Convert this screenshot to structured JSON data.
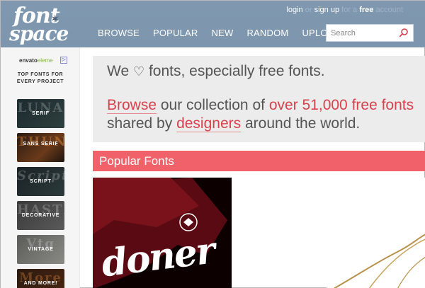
{
  "logo": {
    "line1": "font",
    "line2": "space"
  },
  "auth": {
    "login": "login",
    "or": "or",
    "signup": "sign up",
    "for_a": "for a",
    "free": "free",
    "account": "account"
  },
  "nav": {
    "items": [
      "BROWSE",
      "POPULAR",
      "NEW",
      "RANDOM",
      "UPLOAD"
    ]
  },
  "search": {
    "placeholder": "Search",
    "value": ""
  },
  "sidebar": {
    "ad_brand_a": "envato",
    "ad_brand_b": "eleme",
    "ad_choice": "▷",
    "ad_heading": "TOP FONTS FOR EVERY PROJECT",
    "categories": [
      {
        "label": "SERIF",
        "deco": "LUNA"
      },
      {
        "label": "SANS SERIF",
        "deco": "THUN"
      },
      {
        "label": "SCRIPT",
        "deco": "Script"
      },
      {
        "label": "DECORATIVE",
        "deco": "HASTE"
      },
      {
        "label": "VINTAGE",
        "deco": "Vtg"
      },
      {
        "label": "AND MORE!",
        "deco": "More"
      }
    ]
  },
  "hero": {
    "line1_a": "We",
    "heart": "♡",
    "line1_b": "fonts, especially free fonts.",
    "browse": "Browse",
    "line2_b": "our collection of",
    "count": "over 51,000 free fonts",
    "line3_a": "shared by",
    "designers": "designers",
    "line3_b": "around the world."
  },
  "popular": {
    "title": "Popular Fonts"
  },
  "cards": [
    {
      "preview_text": "doner"
    }
  ],
  "colors": {
    "header": "#7f98b0",
    "accent_red": "#d8414d",
    "bar_red": "#f0616a"
  }
}
